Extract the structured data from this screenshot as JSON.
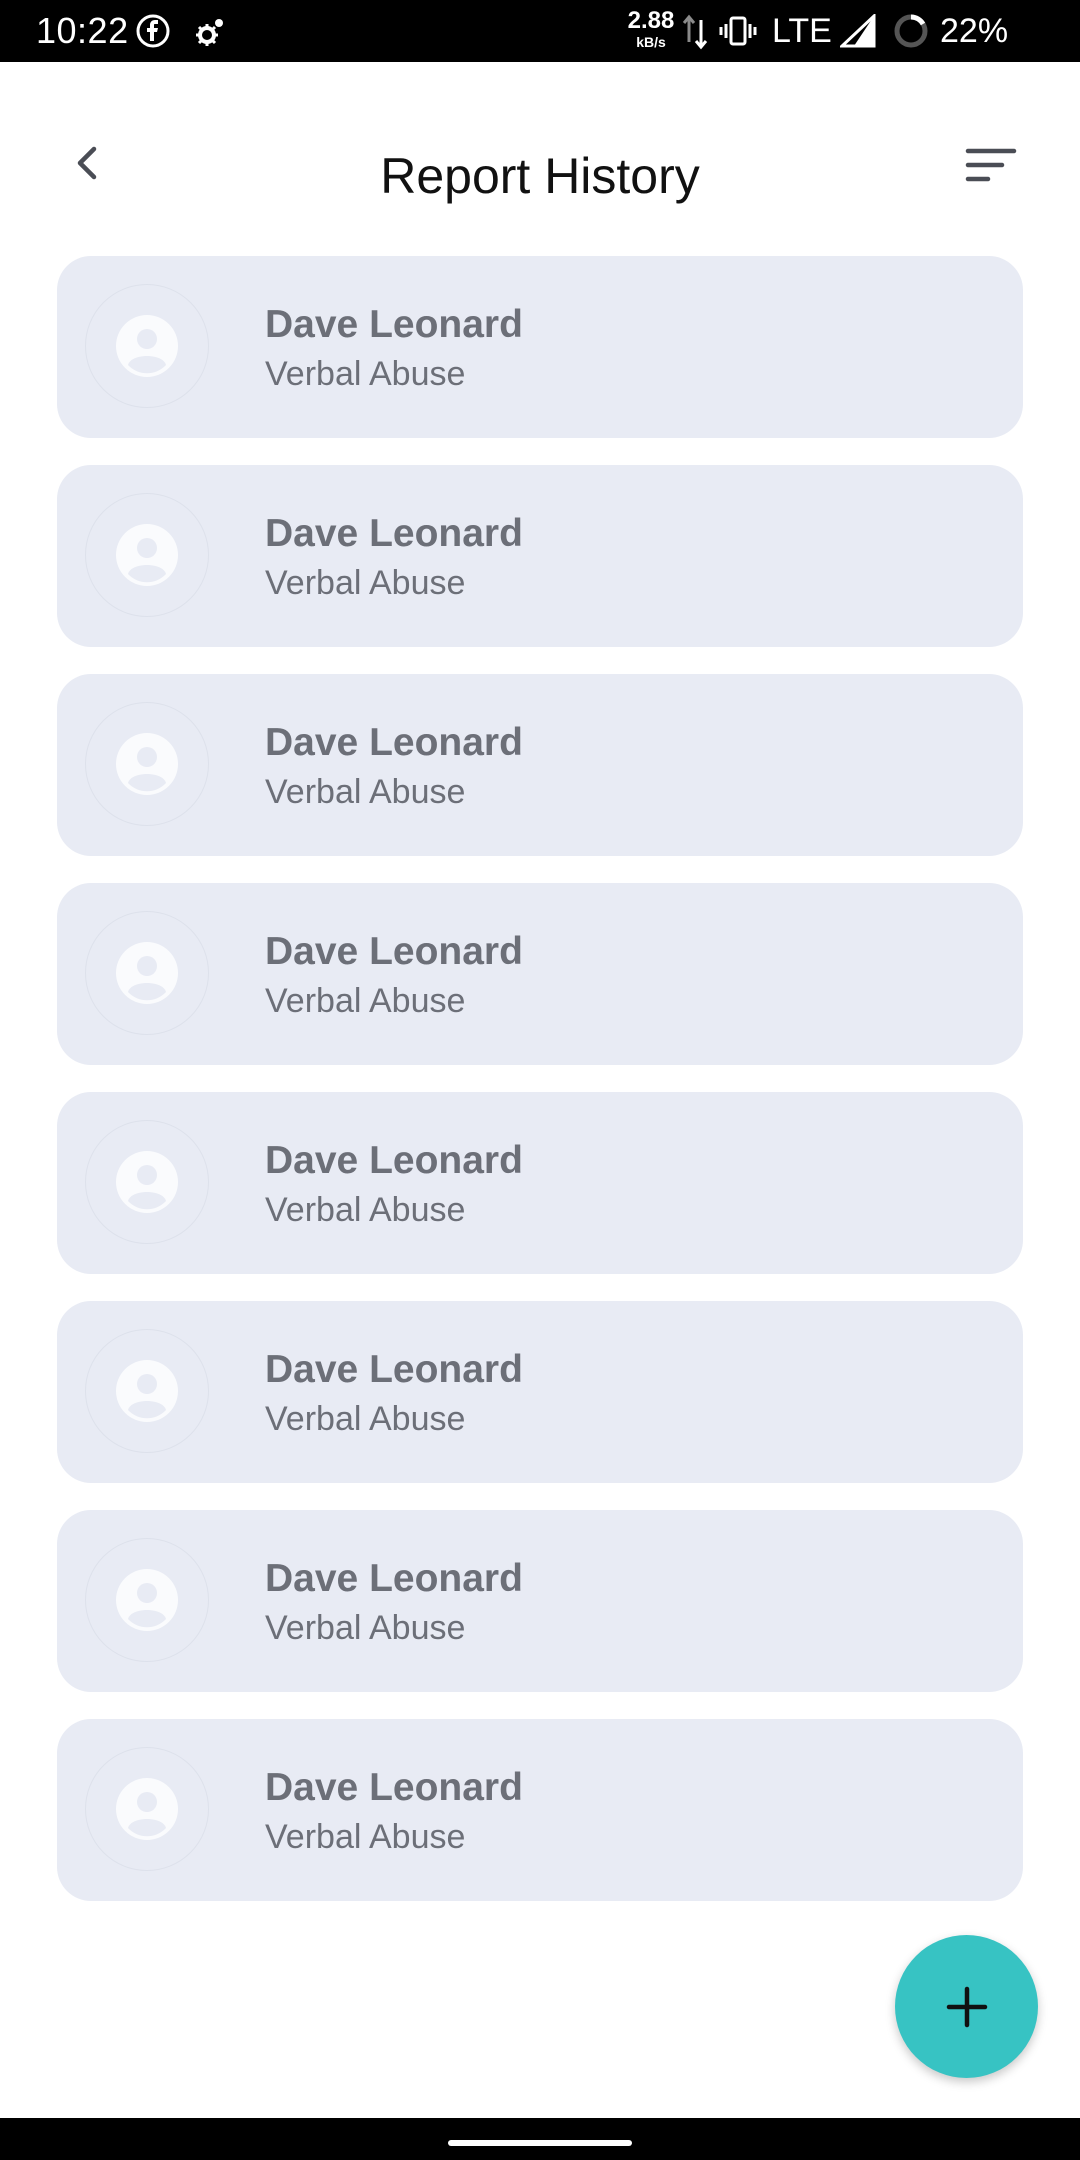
{
  "status_bar": {
    "time": "10:22",
    "speed_value": "2.88",
    "speed_unit": "kB/s",
    "network": "LTE",
    "battery": "22%",
    "icons": [
      "facebook-icon",
      "gear-icon",
      "data-arrows-icon",
      "vibrate-icon",
      "signal-icon",
      "battery-icon"
    ]
  },
  "header": {
    "title": "Report History",
    "back_icon": "chevron-left-icon",
    "sort_icon": "sort-icon"
  },
  "reports": [
    {
      "name": "Dave Leonard",
      "category": "Verbal Abuse"
    },
    {
      "name": "Dave Leonard",
      "category": "Verbal Abuse"
    },
    {
      "name": "Dave Leonard",
      "category": "Verbal Abuse"
    },
    {
      "name": "Dave Leonard",
      "category": "Verbal Abuse"
    },
    {
      "name": "Dave Leonard",
      "category": "Verbal Abuse"
    },
    {
      "name": "Dave Leonard",
      "category": "Verbal Abuse"
    },
    {
      "name": "Dave Leonard",
      "category": "Verbal Abuse"
    },
    {
      "name": "Dave Leonard",
      "category": "Verbal Abuse"
    }
  ],
  "fab": {
    "icon": "plus-icon"
  },
  "colors": {
    "card_background": "#e8ebf4",
    "card_text": "#6c6f78",
    "fab": "#37c3c3",
    "title": "#111111"
  }
}
